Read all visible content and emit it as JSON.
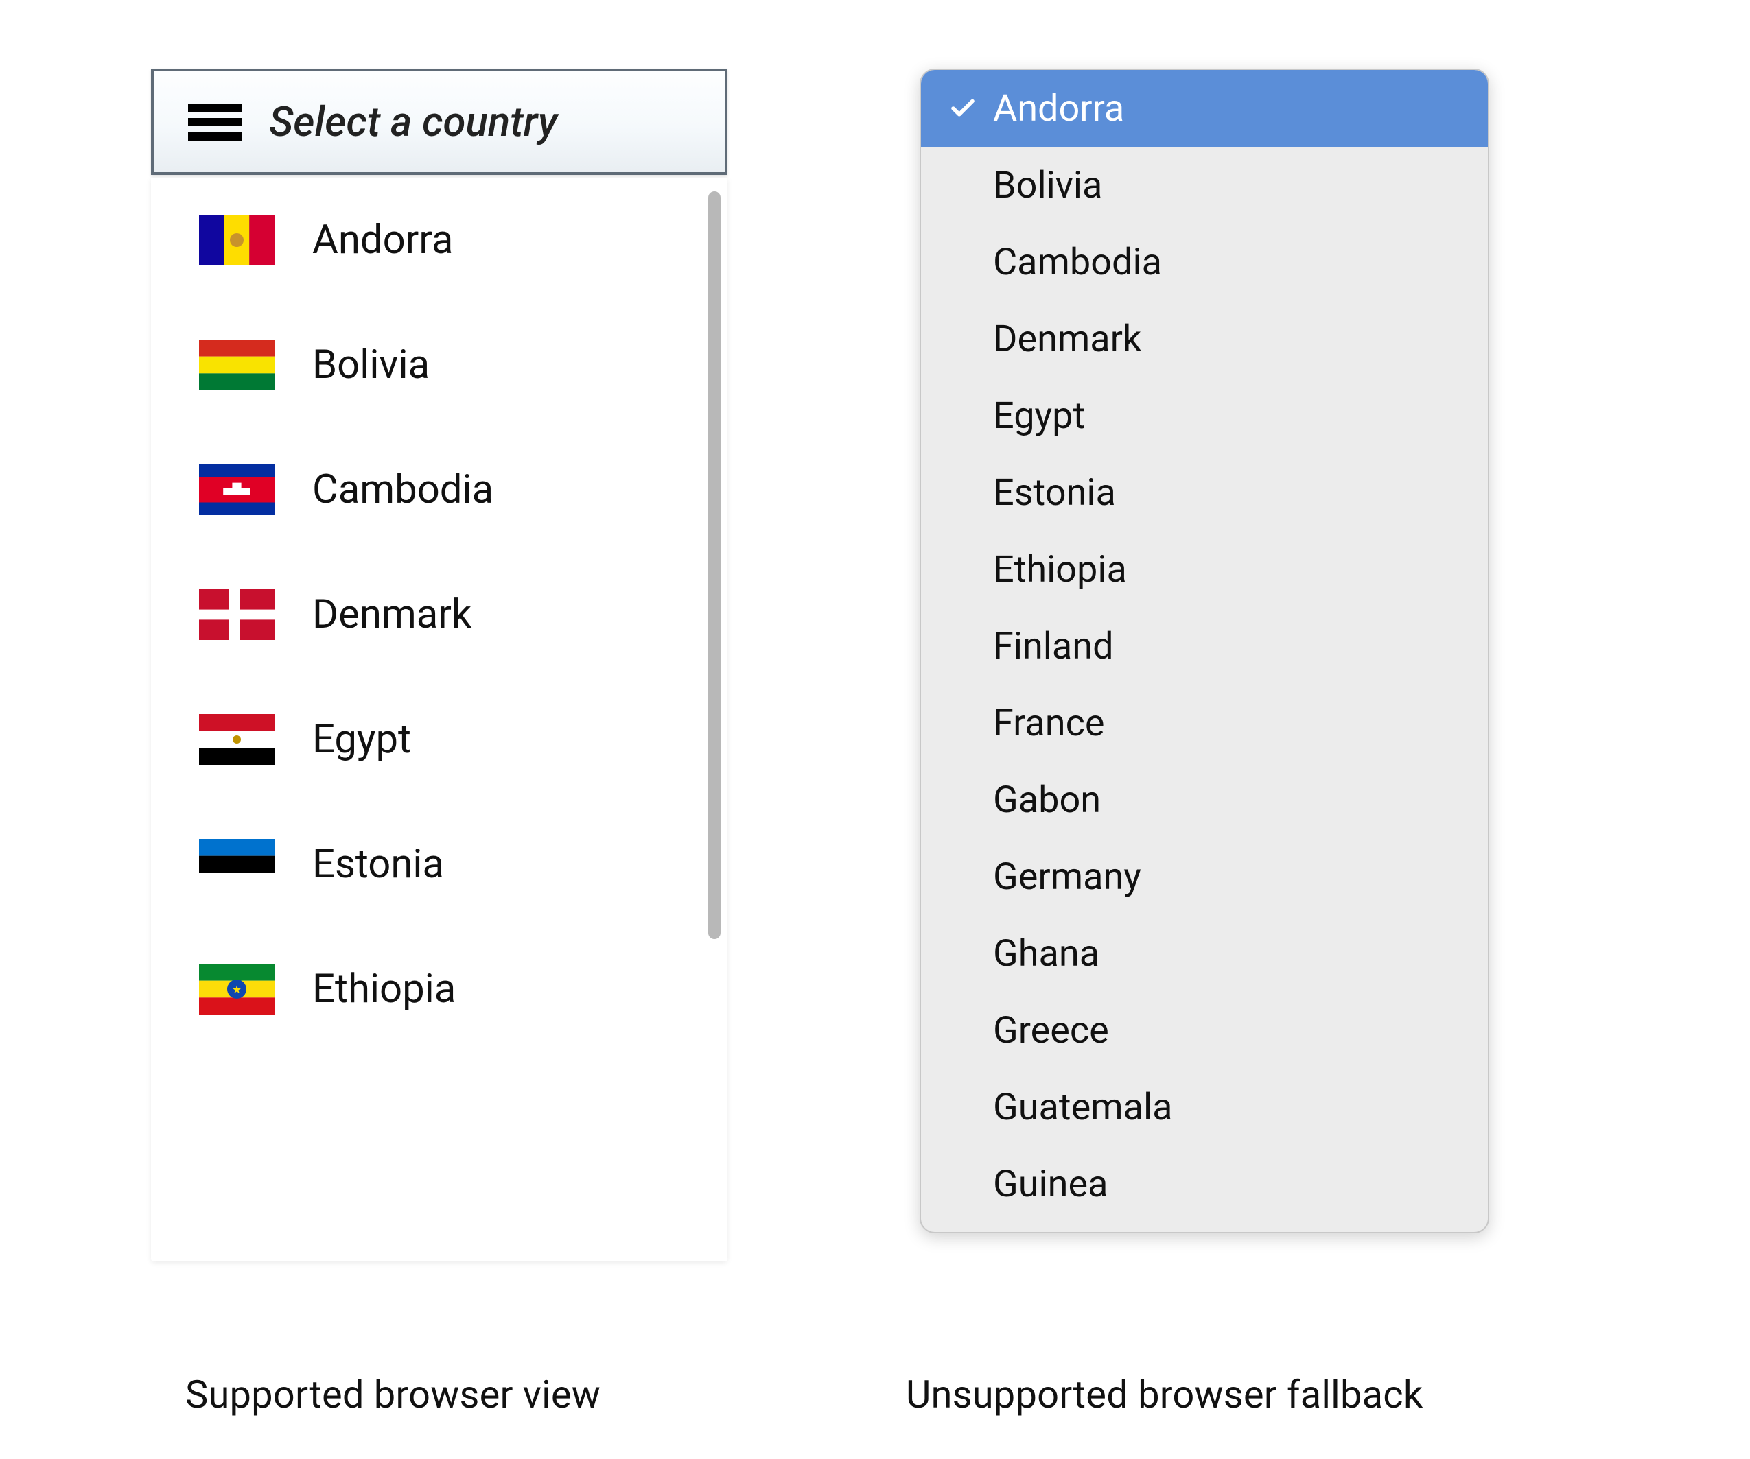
{
  "left": {
    "placeholder": "Select a country",
    "options": [
      {
        "flag": "andorra",
        "label": "Andorra"
      },
      {
        "flag": "bolivia",
        "label": "Bolivia"
      },
      {
        "flag": "cambodia",
        "label": "Cambodia"
      },
      {
        "flag": "denmark",
        "label": "Denmark"
      },
      {
        "flag": "egypt",
        "label": "Egypt"
      },
      {
        "flag": "estonia",
        "label": "Estonia"
      },
      {
        "flag": "ethiopia",
        "label": "Ethiopia"
      }
    ]
  },
  "right": {
    "selected_index": 0,
    "options": [
      "Andorra",
      "Bolivia",
      "Cambodia",
      "Denmark",
      "Egypt",
      "Estonia",
      "Ethiopia",
      "Finland",
      "France",
      "Gabon",
      "Germany",
      "Ghana",
      "Greece",
      "Guatemala",
      "Guinea"
    ]
  },
  "captions": {
    "left": "Supported browser view",
    "right": "Unsupported browser fallback"
  },
  "colors": {
    "native_highlight": "#5b8ed8"
  }
}
